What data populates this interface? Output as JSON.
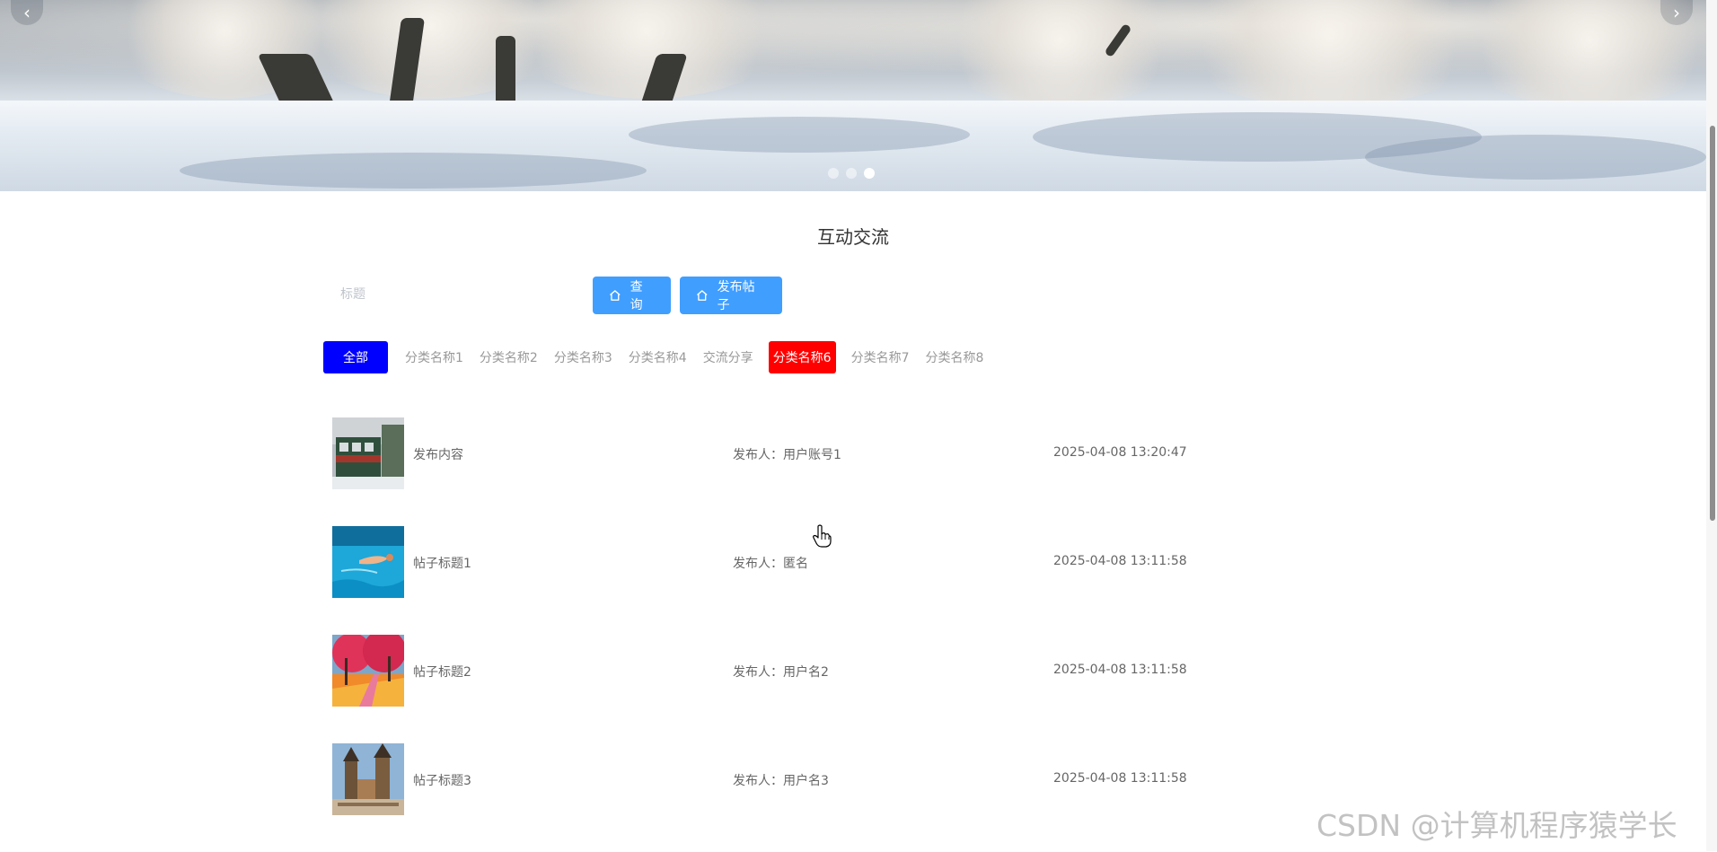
{
  "carousel": {
    "prev_label": "‹",
    "next_label": "›",
    "indicator_count": 3,
    "active_indicator": 3
  },
  "section": {
    "title": "互动交流"
  },
  "search": {
    "placeholder": "标题",
    "query_label": "查询",
    "publish_label": "发布帖子"
  },
  "tabs": [
    {
      "label": "全部",
      "style": "selected-blue"
    },
    {
      "label": "分类名称1",
      "style": "plain"
    },
    {
      "label": "分类名称2",
      "style": "plain"
    },
    {
      "label": "分类名称3",
      "style": "plain"
    },
    {
      "label": "分类名称4",
      "style": "plain"
    },
    {
      "label": "交流分享",
      "style": "plain"
    },
    {
      "label": "分类名称6",
      "style": "highlight-red"
    },
    {
      "label": "分类名称7",
      "style": "plain"
    },
    {
      "label": "分类名称8",
      "style": "plain"
    }
  ],
  "posts": [
    {
      "title": "发布内容",
      "author_label": "发布人：",
      "author": "用户账号1",
      "time": "2025-04-08 13:20:47"
    },
    {
      "title": "帖子标题1",
      "author_label": "发布人：",
      "author": "匿名",
      "time": "2025-04-08 13:11:58"
    },
    {
      "title": "帖子标题2",
      "author_label": "发布人：",
      "author": "用户名2",
      "time": "2025-04-08 13:11:58"
    },
    {
      "title": "帖子标题3",
      "author_label": "发布人：",
      "author": "用户名3",
      "time": "2025-04-08 13:11:58"
    }
  ],
  "watermark": "CSDN @计算机程序猿学长",
  "colors": {
    "primary_button": "#409eff",
    "tab_all": "#0000ff",
    "tab_highlight": "#ff0000"
  }
}
